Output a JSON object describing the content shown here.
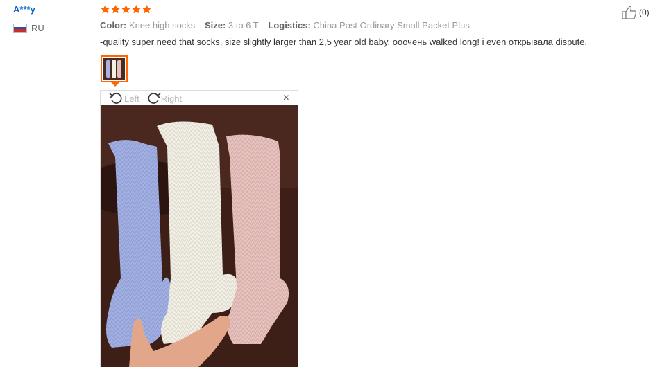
{
  "review": {
    "user_name": "A***y",
    "country_code": "RU",
    "rating": 5,
    "useful_count": "(0)",
    "meta": [
      {
        "label": "Color:",
        "value": "Knee high socks"
      },
      {
        "label": "Size:",
        "value": "3 to 6 T"
      },
      {
        "label": "Logistics:",
        "value": "China Post Ordinary Small Packet Plus"
      }
    ],
    "feedback": "-quality super need that socks, size slightly larger than 2,5 year old baby. ооочень walked long! i even открывала dispute."
  },
  "viewer": {
    "rotate_left_label": "Left",
    "rotate_right_label": "Right",
    "close_symbol": "×"
  },
  "icons": {
    "thumbs_up": "thumbs-up-icon",
    "rotate_left": "rotate-left-icon",
    "rotate_right": "rotate-right-icon",
    "close": "close-icon",
    "flag": "russia-flag-icon",
    "star": "star-icon"
  },
  "colors": {
    "user": "#0e64c8",
    "star": "#f60",
    "thumb_border": "#f60"
  }
}
